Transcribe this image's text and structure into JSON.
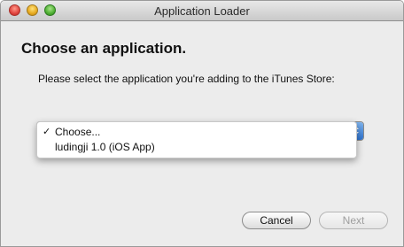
{
  "window": {
    "title": "Application Loader"
  },
  "content": {
    "heading": "Choose an application.",
    "instruction": "Please select the application you're adding to the iTunes Store:"
  },
  "app_popup": {
    "items": [
      {
        "label": "Choose...",
        "checked": true
      },
      {
        "label": "ludingji 1.0 (iOS App)",
        "checked": false
      }
    ],
    "check_glyph": "✓"
  },
  "buttons": {
    "cancel_label": "Cancel",
    "next_label": "Next"
  },
  "colors": {
    "accent": "#2e73cf"
  }
}
